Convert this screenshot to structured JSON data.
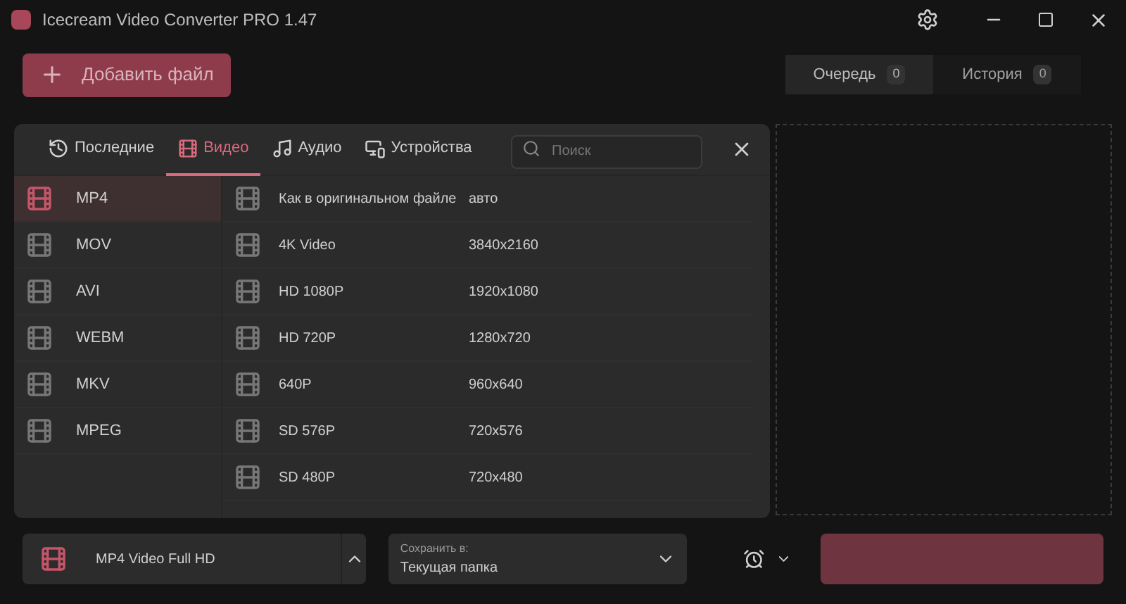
{
  "window": {
    "title": "Icecream Video Converter PRO 1.47"
  },
  "add_button": {
    "label": "Добавить файл"
  },
  "view_tabs": [
    {
      "label": "Очередь",
      "count": "0",
      "selected": true
    },
    {
      "label": "История",
      "count": "0",
      "selected": false
    }
  ],
  "dialog": {
    "tabs": [
      {
        "kind": "recent",
        "label": "Последние",
        "selected": false
      },
      {
        "kind": "video",
        "label": "Видео",
        "selected": true
      },
      {
        "kind": "audio",
        "label": "Аудио",
        "selected": false
      },
      {
        "kind": "devices",
        "label": "Устройства",
        "selected": false
      }
    ],
    "search": {
      "placeholder": "Поиск"
    },
    "formats": [
      {
        "label": "MP4",
        "selected": true
      },
      {
        "label": "MOV",
        "selected": false
      },
      {
        "label": "AVI",
        "selected": false
      },
      {
        "label": "WEBM",
        "selected": false
      },
      {
        "label": "MKV",
        "selected": false
      },
      {
        "label": "MPEG",
        "selected": false
      }
    ],
    "presets": [
      {
        "name": "Как в оригинальном файле",
        "resolution": "авто"
      },
      {
        "name": "4K Video",
        "resolution": "3840x2160"
      },
      {
        "name": "HD 1080P",
        "resolution": "1920x1080"
      },
      {
        "name": "HD 720P",
        "resolution": "1280x720"
      },
      {
        "name": "640P",
        "resolution": "960x640"
      },
      {
        "name": "SD 576P",
        "resolution": "720x576"
      },
      {
        "name": "SD 480P",
        "resolution": "720x480"
      }
    ]
  },
  "bottom_bar": {
    "format": "MP4 Video Full HD",
    "save_label": "Сохранить в:",
    "save_value": "Текущая папка"
  }
}
